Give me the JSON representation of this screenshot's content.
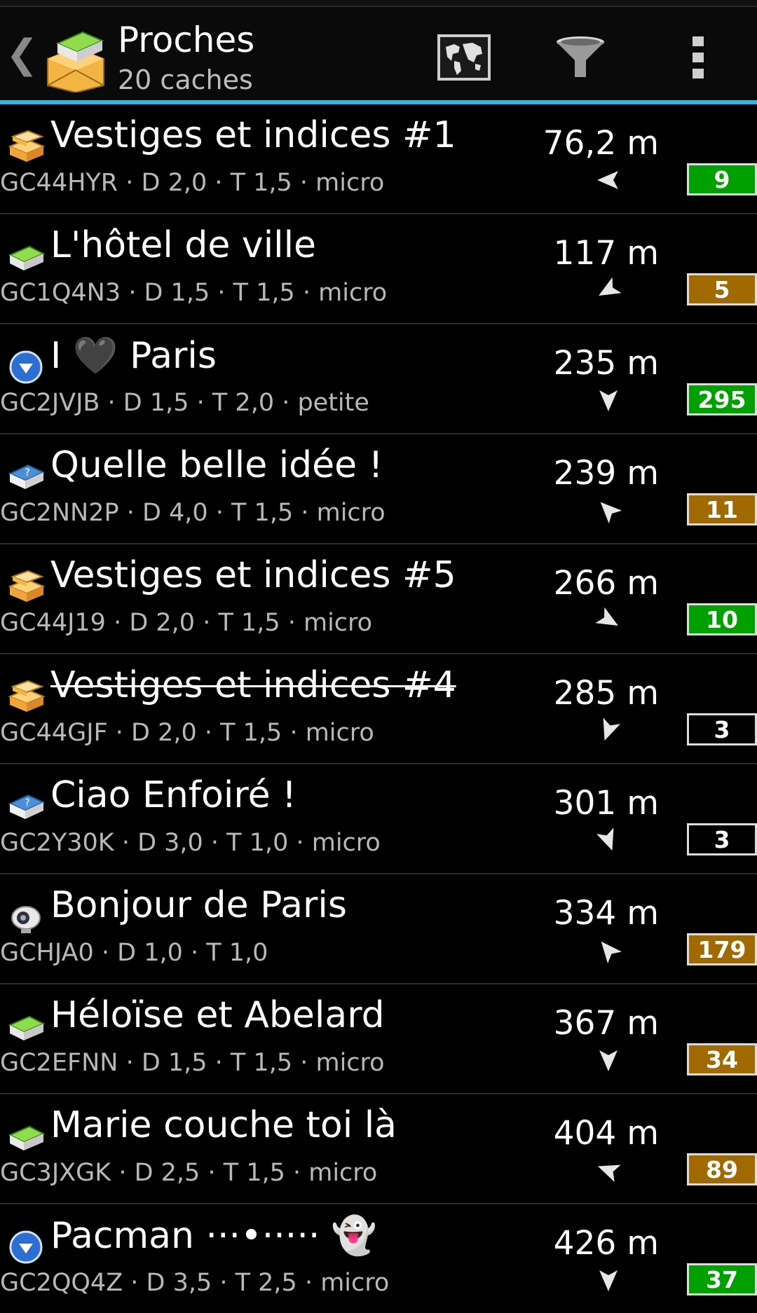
{
  "actionbar": {
    "title": "Proches",
    "subtitle": "20 caches",
    "up_glyph": "❮",
    "icons": [
      "back-chevron-icon",
      "geocache-box-icon",
      "map-icon",
      "filter-icon",
      "overflow-menu-icon"
    ]
  },
  "colors": {
    "accent": "#33b5e5",
    "green_badge": "#00a000",
    "brown_badge": "#a06a00"
  },
  "caches": [
    {
      "name": "Vestiges et indices #1",
      "info": "GC44HYR · D 2,0 · T 1,5 · micro",
      "distance": "76,2 m",
      "count": "9",
      "badge": "green",
      "type": "multi",
      "archived": false,
      "bearing": -90
    },
    {
      "name": "L'hôtel de ville",
      "info": "GC1Q4N3 · D 1,5 · T 1,5 · micro",
      "distance": "117 m",
      "count": "5",
      "badge": "brown",
      "type": "traditional",
      "archived": false,
      "bearing": -120
    },
    {
      "name": "I 🖤 Paris",
      "info": "GC2JVJB · D 1,5 · T 2,0 · petite",
      "distance": "235 m",
      "count": "295",
      "badge": "green",
      "type": "virtual",
      "archived": false,
      "bearing": 180
    },
    {
      "name": "Quelle belle idée !",
      "info": "GC2NN2P · D 4,0 · T 1,5 · micro",
      "distance": "239 m",
      "count": "11",
      "badge": "brown",
      "type": "mystery",
      "archived": false,
      "bearing": -45
    },
    {
      "name": "Vestiges et indices #5",
      "info": "GC44J19 · D 2,0 · T 1,5 · micro",
      "distance": "266 m",
      "count": "10",
      "badge": "green",
      "type": "multi",
      "archived": false,
      "bearing": 120
    },
    {
      "name": "Vestiges et indices #4",
      "info": "GC44GJF · D 2,0 · T 1,5 · micro",
      "distance": "285 m",
      "count": "3",
      "badge": "none",
      "type": "multi",
      "archived": true,
      "bearing": -160
    },
    {
      "name": "Ciao Enfoiré !",
      "info": "GC2Y30K · D 3,0 · T 1,0 · micro",
      "distance": "301 m",
      "count": "3",
      "badge": "none",
      "type": "mystery",
      "archived": false,
      "bearing": 160
    },
    {
      "name": "Bonjour de Paris",
      "info": "GCHJA0 · D 1,0 · T 1,0",
      "distance": "334 m",
      "count": "179",
      "badge": "brown",
      "type": "webcam",
      "archived": false,
      "bearing": -40
    },
    {
      "name": "Héloïse et Abelard",
      "info": "GC2EFNN · D 1,5 · T 1,5 · micro",
      "distance": "367 m",
      "count": "34",
      "badge": "brown",
      "type": "traditional",
      "archived": false,
      "bearing": 180
    },
    {
      "name": "Marie couche toi là",
      "info": "GC3JXGK · D 2,5 · T 1,5 · micro",
      "distance": "404 m",
      "count": "89",
      "badge": "brown",
      "type": "traditional",
      "archived": false,
      "bearing": -70
    },
    {
      "name": "Pacman ···•····· 👻",
      "info": "GC2QQ4Z · D 3,5 · T 2,5 · micro",
      "distance": "426 m",
      "count": "37",
      "badge": "green",
      "type": "virtual",
      "archived": false,
      "bearing": 180
    }
  ]
}
